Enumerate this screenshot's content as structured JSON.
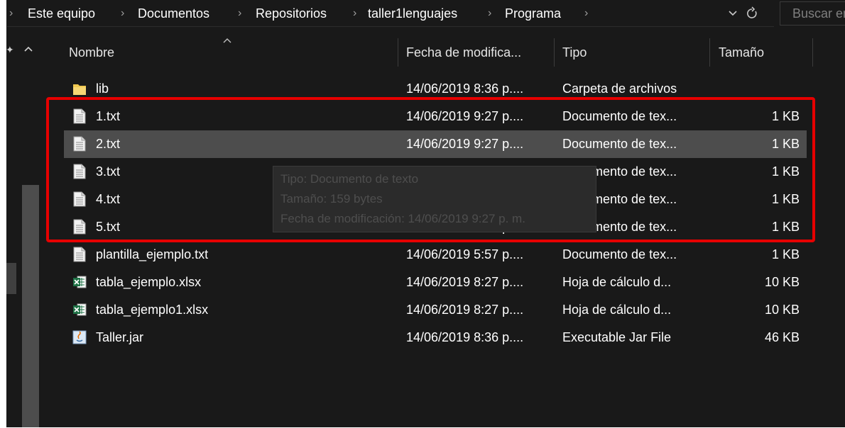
{
  "breadcrumb": {
    "items": [
      "Este equipo",
      "Documentos",
      "Repositorios",
      "taller1lenguajes",
      "Programa"
    ],
    "separator": "›"
  },
  "search": {
    "placeholder": "Buscar en Programa"
  },
  "columns": {
    "name": "Nombre",
    "date": "Fecha de modifica...",
    "type": "Tipo",
    "size": "Tamaño"
  },
  "files": [
    {
      "name": "lib",
      "date": "14/06/2019 8:36 p....",
      "type": "Carpeta de archivos",
      "size": "",
      "icon": "folder-icon"
    },
    {
      "name": "1.txt",
      "date": "14/06/2019 9:27 p....",
      "type": "Documento de tex...",
      "size": "1 KB",
      "icon": "text-file-icon"
    },
    {
      "name": "2.txt",
      "date": "14/06/2019 9:27 p....",
      "type": "Documento de tex...",
      "size": "1 KB",
      "icon": "text-file-icon",
      "hovered": true
    },
    {
      "name": "3.txt",
      "date": "14/06/2019 9:27 p....",
      "type": "Documento de tex...",
      "size": "1 KB",
      "icon": "text-file-icon"
    },
    {
      "name": "4.txt",
      "date": "14/06/2019 9:27 p....",
      "type": "Documento de tex...",
      "size": "1 KB",
      "icon": "text-file-icon"
    },
    {
      "name": "5.txt",
      "date": "14/06/2019 9:27 p....",
      "type": "Documento de tex...",
      "size": "1 KB",
      "icon": "text-file-icon"
    },
    {
      "name": "plantilla_ejemplo.txt",
      "date": "14/06/2019 5:57 p....",
      "type": "Documento de tex...",
      "size": "1 KB",
      "icon": "text-file-icon"
    },
    {
      "name": "tabla_ejemplo.xlsx",
      "date": "14/06/2019 8:27 p....",
      "type": "Hoja de cálculo d...",
      "size": "10 KB",
      "icon": "excel-file-icon"
    },
    {
      "name": "tabla_ejemplo1.xlsx",
      "date": "14/06/2019 8:27 p....",
      "type": "Hoja de cálculo d...",
      "size": "10 KB",
      "icon": "excel-file-icon"
    },
    {
      "name": "Taller.jar",
      "date": "14/06/2019 8:36 p....",
      "type": "Executable Jar File",
      "size": "46 KB",
      "icon": "java-jar-icon"
    }
  ],
  "tooltip": {
    "type": "Tipo: Documento de texto",
    "size": "Tamaño: 159 bytes",
    "modified": "Fecha de modificación: 14/06/2019 9:27 p. m."
  },
  "colors": {
    "background": "#191919",
    "hover_row": "#4d4d4d",
    "highlight": "#e60000",
    "folder": "#f0c850",
    "excel": "#1e7145"
  }
}
